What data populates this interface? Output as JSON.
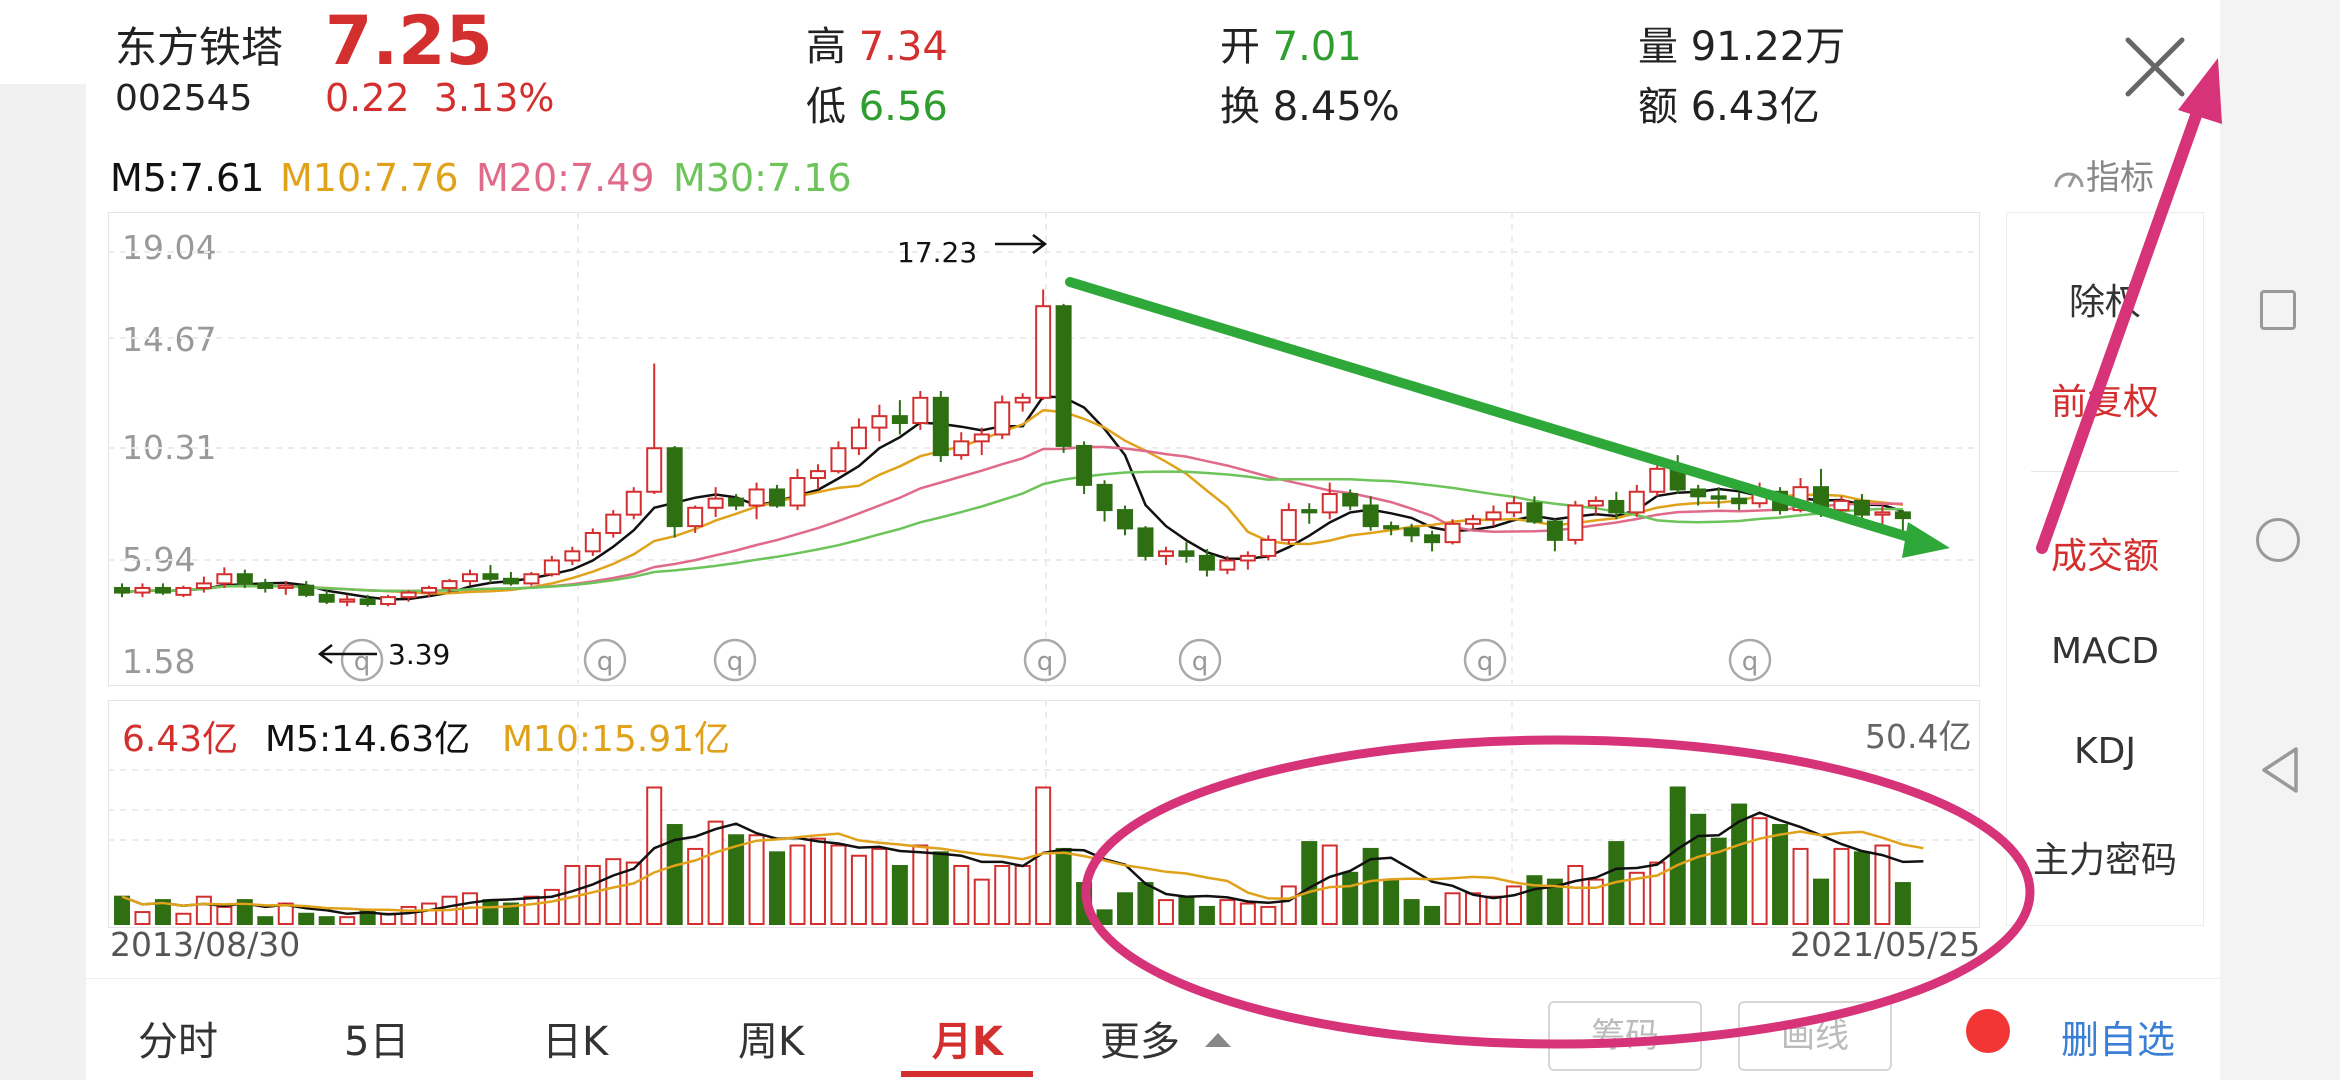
{
  "header": {
    "stock_name": "东方铁塔",
    "stock_code": "002545",
    "price": "7.25",
    "change": "0.22",
    "change_pct": "3.13%",
    "high_label": "高",
    "high_value": "7.34",
    "low_label": "低",
    "low_value": "6.56",
    "open_label": "开",
    "open_value": "7.01",
    "turnover_label": "换",
    "turnover_value": "8.45%",
    "volume_label": "量",
    "volume_value": "91.22万",
    "amount_label": "额",
    "amount_value": "6.43亿"
  },
  "ma_legend": {
    "m5": "M5:7.61",
    "m10": "M10:7.76",
    "m20": "M20:7.49",
    "m30": "M30:7.16"
  },
  "indicator_button": "指标",
  "price_axis": [
    "19.04",
    "14.67",
    "10.31",
    "5.94",
    "1.58"
  ],
  "annotations": {
    "high": "17.23",
    "low": "3.39"
  },
  "volume_panel": {
    "amount": "6.43亿",
    "m5": "M5:14.63亿",
    "m10": "M10:15.91亿",
    "max": "50.4亿"
  },
  "dates": {
    "start": "2013/08/30",
    "end": "2021/05/25"
  },
  "side_menu": [
    "除权",
    "前复权",
    "成交额",
    "MACD",
    "KDJ",
    "主力密码"
  ],
  "tabs": [
    "分时",
    "5日",
    "日K",
    "周K",
    "月K",
    "更多"
  ],
  "buttons": {
    "chips": "筹码",
    "draw": "画线",
    "remove_fav": "删自选"
  },
  "colors": {
    "up": "#d32f2f",
    "down": "#2e6f12",
    "ma5": "#111111",
    "ma10": "#e0a21a",
    "ma20": "#e06a8a",
    "ma30": "#6cc45a",
    "trend_arrow": "#2fa83a",
    "markup": "#d63378"
  },
  "icons": [
    "close-icon",
    "indicator-gauge-icon",
    "dropdown-triangle-icon",
    "nav-square-icon",
    "nav-circle-icon",
    "nav-back-icon"
  ],
  "chart_data": {
    "type": "candlestick",
    "period": "monthly",
    "ylim": [
      1.58,
      19.04
    ],
    "vol_max": 50.4,
    "candles": [
      [
        4.2,
        4.4,
        3.8,
        4.0
      ],
      [
        4.0,
        4.4,
        3.8,
        4.2
      ],
      [
        4.2,
        4.4,
        3.9,
        4.0
      ],
      [
        3.9,
        4.3,
        3.8,
        4.2
      ],
      [
        4.2,
        4.7,
        4.0,
        4.4
      ],
      [
        4.4,
        5.1,
        4.2,
        4.8
      ],
      [
        4.8,
        5.0,
        4.2,
        4.4
      ],
      [
        4.4,
        4.6,
        4.0,
        4.2
      ],
      [
        4.2,
        4.5,
        3.9,
        4.3
      ],
      [
        4.3,
        4.5,
        3.8,
        3.9
      ],
      [
        3.9,
        4.1,
        3.5,
        3.6
      ],
      [
        3.6,
        3.9,
        3.4,
        3.7
      ],
      [
        3.7,
        3.9,
        3.39,
        3.5
      ],
      [
        3.5,
        3.9,
        3.4,
        3.8
      ],
      [
        3.8,
        4.1,
        3.6,
        4.0
      ],
      [
        4.0,
        4.3,
        3.8,
        4.2
      ],
      [
        4.2,
        4.6,
        4.0,
        4.5
      ],
      [
        4.5,
        5.0,
        4.3,
        4.8
      ],
      [
        4.8,
        5.2,
        4.4,
        4.6
      ],
      [
        4.6,
        4.9,
        4.3,
        4.4
      ],
      [
        4.4,
        4.9,
        4.3,
        4.8
      ],
      [
        4.8,
        5.6,
        4.7,
        5.4
      ],
      [
        5.4,
        6.0,
        5.2,
        5.8
      ],
      [
        5.8,
        6.8,
        5.6,
        6.6
      ],
      [
        6.6,
        7.6,
        6.4,
        7.4
      ],
      [
        7.4,
        8.6,
        7.2,
        8.4
      ],
      [
        8.4,
        14.0,
        8.3,
        10.3
      ],
      [
        10.3,
        10.4,
        6.4,
        6.9
      ],
      [
        6.9,
        7.8,
        6.6,
        7.7
      ],
      [
        7.7,
        8.6,
        7.3,
        8.1
      ],
      [
        8.1,
        8.3,
        7.6,
        7.8
      ],
      [
        7.8,
        8.8,
        7.2,
        8.5
      ],
      [
        8.5,
        8.7,
        7.7,
        7.8
      ],
      [
        7.8,
        9.4,
        7.6,
        9.0
      ],
      [
        9.0,
        9.6,
        8.5,
        9.3
      ],
      [
        9.3,
        10.6,
        9.2,
        10.3
      ],
      [
        10.3,
        11.6,
        10.0,
        11.2
      ],
      [
        11.2,
        12.2,
        10.6,
        11.7
      ],
      [
        11.7,
        12.4,
        10.9,
        11.4
      ],
      [
        11.4,
        12.8,
        11.1,
        12.5
      ],
      [
        12.5,
        12.8,
        9.7,
        10.0
      ],
      [
        10.0,
        11.0,
        9.8,
        10.6
      ],
      [
        10.6,
        11.2,
        10.0,
        10.9
      ],
      [
        10.9,
        12.6,
        10.7,
        12.3
      ],
      [
        12.3,
        12.7,
        11.9,
        12.5
      ],
      [
        12.5,
        17.23,
        12.4,
        16.5
      ],
      [
        16.5,
        16.6,
        10.1,
        10.4
      ],
      [
        10.4,
        10.6,
        8.3,
        8.7
      ],
      [
        8.7,
        8.9,
        7.1,
        7.6
      ],
      [
        7.6,
        7.8,
        6.5,
        6.8
      ],
      [
        6.8,
        6.9,
        5.4,
        5.6
      ],
      [
        5.6,
        6.0,
        5.2,
        5.8
      ],
      [
        5.8,
        6.2,
        5.3,
        5.6
      ],
      [
        5.6,
        5.9,
        4.7,
        5.0
      ],
      [
        5.0,
        5.6,
        4.8,
        5.4
      ],
      [
        5.4,
        5.8,
        5.0,
        5.6
      ],
      [
        5.6,
        6.5,
        5.4,
        6.3
      ],
      [
        6.3,
        7.9,
        6.1,
        7.6
      ],
      [
        7.6,
        7.9,
        7.0,
        7.5
      ],
      [
        7.5,
        8.8,
        7.2,
        8.3
      ],
      [
        8.3,
        8.5,
        7.6,
        7.8
      ],
      [
        7.8,
        8.2,
        6.7,
        6.9
      ],
      [
        6.9,
        7.1,
        6.5,
        6.8
      ],
      [
        6.8,
        7.0,
        6.2,
        6.5
      ],
      [
        6.5,
        6.7,
        5.8,
        6.2
      ],
      [
        6.2,
        7.2,
        6.1,
        7.0
      ],
      [
        7.0,
        7.4,
        6.8,
        7.2
      ],
      [
        7.2,
        7.8,
        6.9,
        7.5
      ],
      [
        7.5,
        8.2,
        7.3,
        7.9
      ],
      [
        7.9,
        8.2,
        7.0,
        7.1
      ],
      [
        7.1,
        7.2,
        5.8,
        6.3
      ],
      [
        6.3,
        8.0,
        6.1,
        7.8
      ],
      [
        7.8,
        8.2,
        7.4,
        8.0
      ],
      [
        8.0,
        8.4,
        7.2,
        7.5
      ],
      [
        7.5,
        8.7,
        7.3,
        8.4
      ],
      [
        8.4,
        9.8,
        8.2,
        9.4
      ],
      [
        9.4,
        10.0,
        8.3,
        8.5
      ],
      [
        8.5,
        8.7,
        7.8,
        8.2
      ],
      [
        8.2,
        8.6,
        7.7,
        8.1
      ],
      [
        8.1,
        8.4,
        7.6,
        7.9
      ],
      [
        7.9,
        8.8,
        7.7,
        8.4
      ],
      [
        8.4,
        8.6,
        7.4,
        7.6
      ],
      [
        7.6,
        9.0,
        7.5,
        8.6
      ],
      [
        8.6,
        9.4,
        7.3,
        7.6
      ],
      [
        7.6,
        8.2,
        7.1,
        8.0
      ],
      [
        8.0,
        8.3,
        7.2,
        7.4
      ],
      [
        7.4,
        7.8,
        6.9,
        7.5
      ],
      [
        7.5,
        7.6,
        6.56,
        7.25
      ]
    ],
    "volumes": [
      8,
      3.5,
      7,
      3,
      8,
      5,
      7,
      2,
      6,
      3,
      2,
      2,
      4,
      3,
      5,
      6,
      8,
      9,
      7,
      6,
      8,
      10,
      17,
      17,
      19,
      18,
      40,
      29,
      22,
      30,
      26,
      26,
      21,
      23,
      25,
      23,
      20,
      22,
      17,
      23,
      21,
      17,
      13,
      17,
      17,
      40,
      22,
      12,
      4,
      9,
      12,
      7,
      8,
      5,
      7,
      6,
      5,
      11,
      24,
      23,
      15,
      22,
      13,
      7,
      5,
      9,
      9,
      8,
      11,
      14,
      13,
      17,
      13,
      24,
      15,
      18,
      40,
      32,
      25,
      35,
      31,
      29,
      22,
      13,
      22,
      21,
      23,
      12,
      14
    ]
  }
}
